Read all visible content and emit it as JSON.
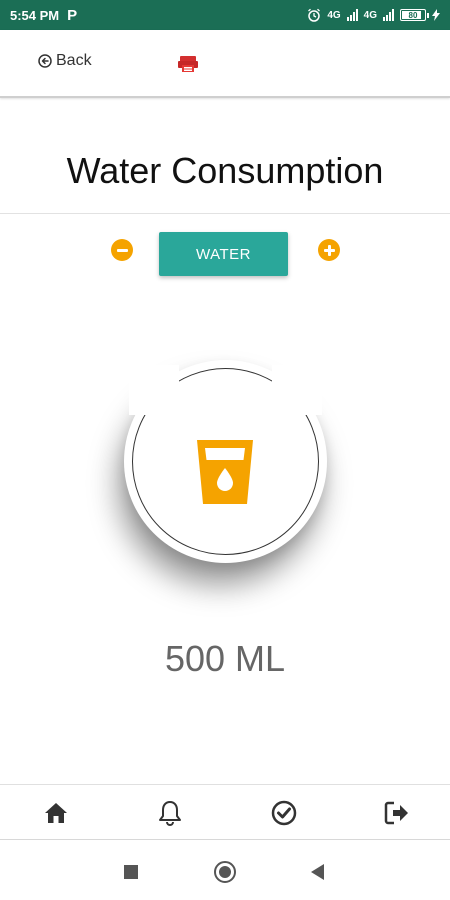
{
  "status_bar": {
    "time": "5:54 PM",
    "app_indicator": "P",
    "network_label_1": "4G",
    "network_label_2": "4G",
    "battery_text": "80"
  },
  "header": {
    "back_label": "Back",
    "back_icon": "circle-arrow-left-icon",
    "logo_icon": "red-logo-icon"
  },
  "page": {
    "title": "Water Consumption"
  },
  "controls": {
    "decrease_icon": "minus-circle-icon",
    "increase_icon": "plus-circle-icon",
    "water_button_label": "WATER"
  },
  "display": {
    "icon": "water-glass-icon",
    "amount": "500 ML"
  },
  "bottom_nav": {
    "items": [
      {
        "icon": "home-icon"
      },
      {
        "icon": "bell-icon"
      },
      {
        "icon": "check-circle-icon"
      },
      {
        "icon": "logout-icon"
      }
    ]
  },
  "colors": {
    "status_bar": "#1b6e55",
    "accent_orange": "#f5a300",
    "button_teal": "#2aa79a",
    "amount_text": "#666666"
  }
}
